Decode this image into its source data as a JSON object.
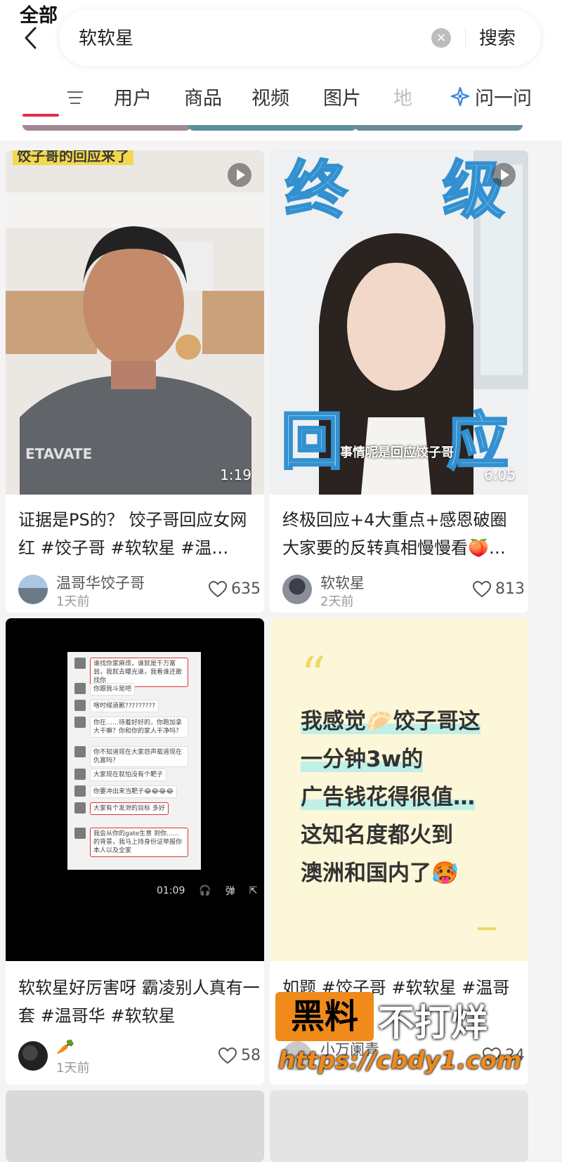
{
  "search": {
    "query": "软软星",
    "submit_label": "搜索"
  },
  "tabs": [
    {
      "label": "全部"
    },
    {
      "label": "用户"
    },
    {
      "label": "商品"
    },
    {
      "label": "视频"
    },
    {
      "label": "图片"
    },
    {
      "label": "地"
    }
  ],
  "ask": {
    "label": "问一问"
  },
  "cards": [
    {
      "title": "证据是PS的？ 饺子哥回应女网红 #饺子哥 #软软星 #温…",
      "author": "温哥华饺子哥",
      "time": "1天前",
      "likes": "635",
      "duration": "1:19",
      "overlay_text": "饺子哥的回应来了",
      "shirt_text": "ETAVATE"
    },
    {
      "title": "终极回应+4大重点+感恩破圈 大家要的反转真相慢慢看🍑…",
      "author": "软软星",
      "time": "2天前",
      "likes": "813",
      "duration": "6:05",
      "big_text_1": "终",
      "big_text_2": "级",
      "big_text_3": "回",
      "big_text_4": "应",
      "caption": "事情呢是回应饺子哥"
    },
    {
      "title": "软软星好厉害呀 霸凌别人真有一套 #温哥华 #软软星",
      "author": "🥕",
      "time": "1天前",
      "likes": "58",
      "player_time": "01:09",
      "player_danmu": "弹"
    },
    {
      "title": "如题 #饺子哥 #软软星 #温哥",
      "author": "小万阑青",
      "time": "",
      "likes": "24",
      "quote_mark": "“",
      "note_lines": [
        "我感觉🥟饺子哥这",
        "一分钟3w的",
        "广告钱花得很值…",
        "这知名度都火到",
        "澳洲和国内了🥵"
      ]
    }
  ],
  "chat_lines": [
    "谁找你家麻烦，谁就是千万富翁，我就去曝光谁，我看谁还敢找你",
    "你跟我斗是吧",
    "啥时候道歉?????????",
    "你在……待着好好的，你跑加拿大干嘛？你和你的家人干净吗？",
    "你不知道现在大家怨声载道现在仇富吗？",
    "大家现在就怕没有个靶子",
    "你要冲出来当靶子😂😂😂😂",
    "大家有个发泄的目标 多好",
    "我会从你的gate生意 到你……的背景，我马上持身份证举报你本人以及全家"
  ],
  "watermark": {
    "box": "黑料",
    "text": "不打烊",
    "url": "https://cbdy1.com"
  },
  "colors": {
    "accent": "#e02d4a",
    "chip_1": "#a28693",
    "chip_2": "#5a8f9c",
    "chip_3": "#6e8a98"
  }
}
